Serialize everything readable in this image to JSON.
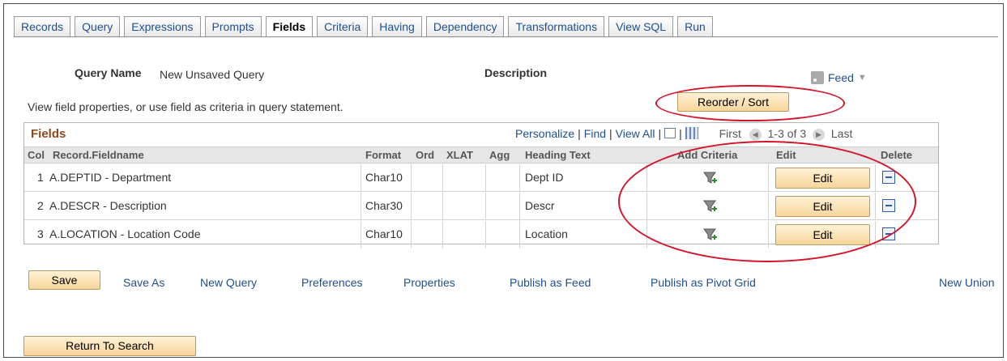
{
  "tabs": [
    "Records",
    "Query",
    "Expressions",
    "Prompts",
    "Fields",
    "Criteria",
    "Having",
    "Dependency",
    "Transformations",
    "View SQL",
    "Run"
  ],
  "active_tab": "Fields",
  "query_name_label": "Query Name",
  "query_name_value": "New Unsaved Query",
  "description_label": "Description",
  "feed_label": "Feed",
  "reorder_label": "Reorder / Sort",
  "instruction": "View field properties, or use field as criteria in query statement.",
  "grid": {
    "title": "Fields",
    "personalize": "Personalize",
    "find": "Find",
    "view_all": "View All",
    "first": "First",
    "range": "1-3 of 3",
    "last": "Last",
    "headers": {
      "col": "Col",
      "fieldname": "Record.Fieldname",
      "format": "Format",
      "ord": "Ord",
      "xlat": "XLAT",
      "agg": "Agg",
      "heading": "Heading Text",
      "criteria": "Add Criteria",
      "edit": "Edit",
      "delete": "Delete"
    },
    "rows": [
      {
        "col": "1",
        "fieldname": "A.DEPTID - Department",
        "format": "Char10",
        "heading": "Dept ID",
        "edit": "Edit"
      },
      {
        "col": "2",
        "fieldname": "A.DESCR - Description",
        "format": "Char30",
        "heading": "Descr",
        "edit": "Edit"
      },
      {
        "col": "3",
        "fieldname": "A.LOCATION - Location Code",
        "format": "Char10",
        "heading": "Location",
        "edit": "Edit"
      }
    ]
  },
  "actions": {
    "save": "Save",
    "save_as": "Save As",
    "new_query": "New Query",
    "preferences": "Preferences",
    "properties": "Properties",
    "publish_feed": "Publish as Feed",
    "publish_pivot": "Publish as Pivot Grid",
    "new_union": "New Union"
  },
  "return_to_search": "Return To Search",
  "colors": {
    "annotation_oval": "#d4142a",
    "button": "#f7d59a",
    "link": "#1f4f8f",
    "grid_title": "#8b4a1a"
  }
}
